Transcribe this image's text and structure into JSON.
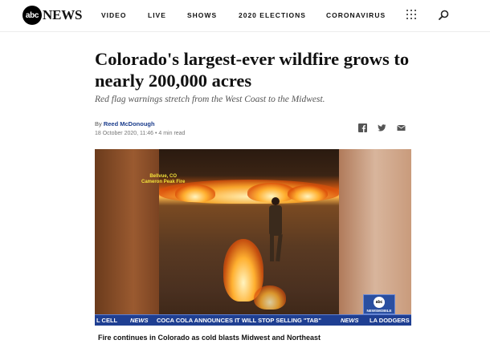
{
  "header": {
    "logo_abc": "abc",
    "logo_news": "NEWS",
    "nav": [
      "VIDEO",
      "LIVE",
      "SHOWS",
      "2020 ELECTIONS",
      "CORONAVIRUS"
    ],
    "menu_icon": "grid-icon",
    "search_icon": "search-icon"
  },
  "article": {
    "headline": "Colorado's largest-ever wildfire grows to nearly 200,000 acres",
    "dek": "Red flag warnings stretch from the West Coast to the Midwest.",
    "byline_prefix": "By ",
    "author": "Reed McDonough",
    "dateline": "18 October 2020, 11:46 • 4 min read",
    "share_icons": [
      "facebook-icon",
      "twitter-icon",
      "email-icon"
    ]
  },
  "video": {
    "overlay_text_1": "Bellvue, CO",
    "overlay_text_2": "Cameron Peak Fire",
    "bug_logo": "abc",
    "bug_text": "NEWSMOBILE",
    "ticker": [
      "L CELL",
      "NEWS",
      "COCA COLA ANNOUNCES IT WILL STOP SELLING \"TAB\"",
      "NEWS",
      "LA DODGERS"
    ],
    "caption": "Fire continues in Colorado as cold blasts Midwest and Northeast"
  }
}
